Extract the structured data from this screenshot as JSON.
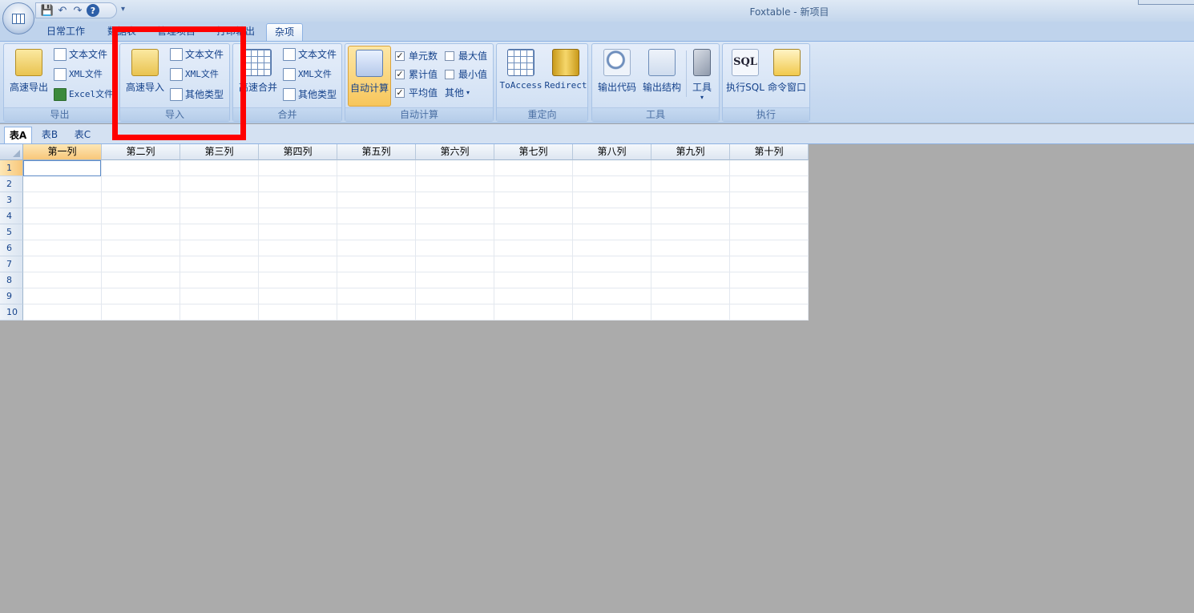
{
  "window": {
    "title": "Foxtable - 新项目"
  },
  "quick_access": {
    "icons": [
      "save-icon",
      "undo-icon",
      "redo-icon",
      "help-icon",
      "customize-dropdown-icon"
    ]
  },
  "tabs": [
    "日常工作",
    "数据表",
    "管理项目",
    "打印输出",
    "杂项"
  ],
  "active_tab": "杂项",
  "ribbon": {
    "export": {
      "label": "导出",
      "big": "高速导出",
      "items": [
        "文本文件",
        "XML文件",
        "Excel文件"
      ]
    },
    "import": {
      "label": "导入",
      "big": "高速导入",
      "items": [
        "文本文件",
        "XML文件",
        "其他类型"
      ]
    },
    "merge": {
      "label": "合并",
      "big": "高速合并",
      "items": [
        "文本文件",
        "XML文件",
        "其他类型"
      ]
    },
    "autocalc": {
      "label": "自动计算",
      "big": "自动计算",
      "checks": [
        {
          "label": "单元数",
          "checked": true
        },
        {
          "label": "累计值",
          "checked": true
        },
        {
          "label": "平均值",
          "checked": true
        },
        {
          "label": "最大值",
          "checked": false
        },
        {
          "label": "最小值",
          "checked": false
        }
      ],
      "other": "其他"
    },
    "redirect": {
      "label": "重定向",
      "buttons": [
        "ToAccess",
        "Redirect"
      ]
    },
    "tools": {
      "label": "工具",
      "buttons": [
        "输出代码",
        "输出结构",
        "工具"
      ]
    },
    "execute": {
      "label": "执行",
      "buttons": [
        "执行SQL",
        "命令窗口"
      ]
    }
  },
  "sheet_tabs": [
    "表A",
    "表B",
    "表C"
  ],
  "active_sheet": "表A",
  "table": {
    "columns": [
      "第一列",
      "第二列",
      "第三列",
      "第四列",
      "第五列",
      "第六列",
      "第七列",
      "第八列",
      "第九列",
      "第十列"
    ],
    "rows": [
      "1",
      "2",
      "3",
      "4",
      "5",
      "6",
      "7",
      "8",
      "9",
      "10"
    ]
  },
  "colors": {
    "highlight_box": "#ff0000",
    "ribbon_bg": "#c7d9f0",
    "workspace_bg": "#ababab"
  }
}
